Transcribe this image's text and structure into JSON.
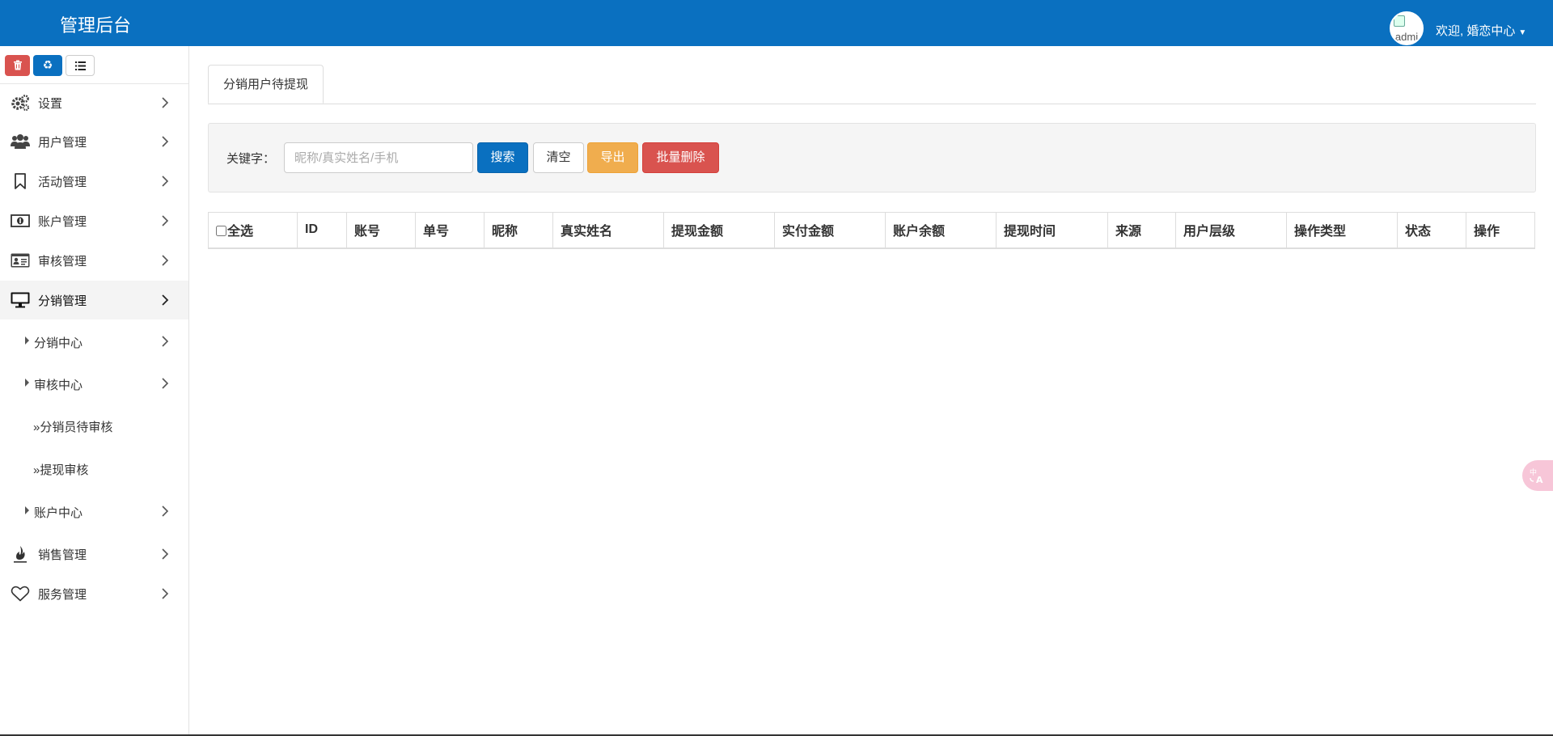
{
  "header": {
    "app_title": "管理后台",
    "avatar_alt": "admi",
    "welcome_text": "欢迎, 婚恋中心"
  },
  "sidebar": {
    "toolbar": [
      {
        "name": "delete-tool-button",
        "icon": "trash-icon"
      },
      {
        "name": "recycle-tool-button",
        "icon": "recycle-icon"
      },
      {
        "name": "list-tool-button",
        "icon": "list-icon"
      }
    ],
    "menu": [
      {
        "label": "设置",
        "icon": "gears-icon"
      },
      {
        "label": "用户管理",
        "icon": "users-icon"
      },
      {
        "label": "活动管理",
        "icon": "bookmark-icon"
      },
      {
        "label": "账户管理",
        "icon": "money-icon"
      },
      {
        "label": "审核管理",
        "icon": "id-card-icon"
      },
      {
        "label": "分销管理",
        "icon": "monitor-icon",
        "active": true
      },
      {
        "label": "销售管理",
        "icon": "fire-icon"
      },
      {
        "label": "服务管理",
        "icon": "heart-icon"
      }
    ],
    "submenu": [
      {
        "label": "分销中心"
      },
      {
        "label": "审核中心"
      },
      {
        "label": "账户中心"
      }
    ],
    "leaves": [
      {
        "label": "分销员待审核"
      },
      {
        "label": "提现审核"
      }
    ],
    "leaf_marker": "»"
  },
  "main": {
    "tab_label": "分销用户待提现",
    "filter": {
      "keyword_label": "关键字：",
      "keyword_placeholder": "昵称/真实姓名/手机",
      "keyword_value": "",
      "search_label": "搜索",
      "clear_label": "清空",
      "export_label": "导出",
      "bulk_delete_label": "批量删除"
    },
    "table": {
      "select_all_label": "全选",
      "columns": [
        "ID",
        "账号",
        "单号",
        "昵称",
        "真实姓名",
        "提现金额",
        "实付金额",
        "账户余额",
        "提现时间",
        "来源",
        "用户层级",
        "操作类型",
        "状态",
        "操作"
      ],
      "rows": []
    }
  },
  "colors": {
    "primary": "#0a70c0",
    "danger": "#d9534f",
    "warning": "#f0ad4e"
  }
}
